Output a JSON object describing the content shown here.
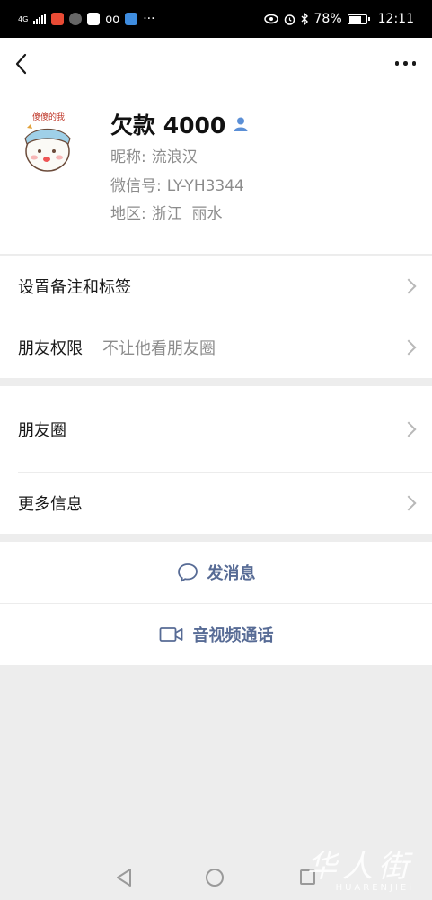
{
  "status_bar": {
    "network": "4G",
    "battery_percent": "78%",
    "time": "12:11",
    "more_dots": "···",
    "battery_level": 0.78
  },
  "header": {
    "back_icon": "chevron-left-icon",
    "more_icon": "more-dots-icon"
  },
  "profile": {
    "name": "欠款 4000",
    "gender_icon": "male-icon",
    "gender_color": "#5b8fd6",
    "nickname_label": "昵称:",
    "nickname": "流浪汉",
    "wechat_id_label": "微信号:",
    "wechat_id": "LY-YH3344",
    "region_label": "地区:",
    "region": "浙江  丽水",
    "avatar_caption": "傻傻的我"
  },
  "rows": {
    "remark_tags": "设置备注和标签",
    "friend_permission": "朋友权限",
    "friend_permission_value": "不让他看朋友圈",
    "moments": "朋友圈",
    "more_info": "更多信息"
  },
  "actions": {
    "send_message": "发消息",
    "av_call": "音视频通话",
    "accent": "#576b95"
  },
  "watermark": {
    "text_cn": "华人街",
    "text_en": "HUARENJIEi"
  }
}
